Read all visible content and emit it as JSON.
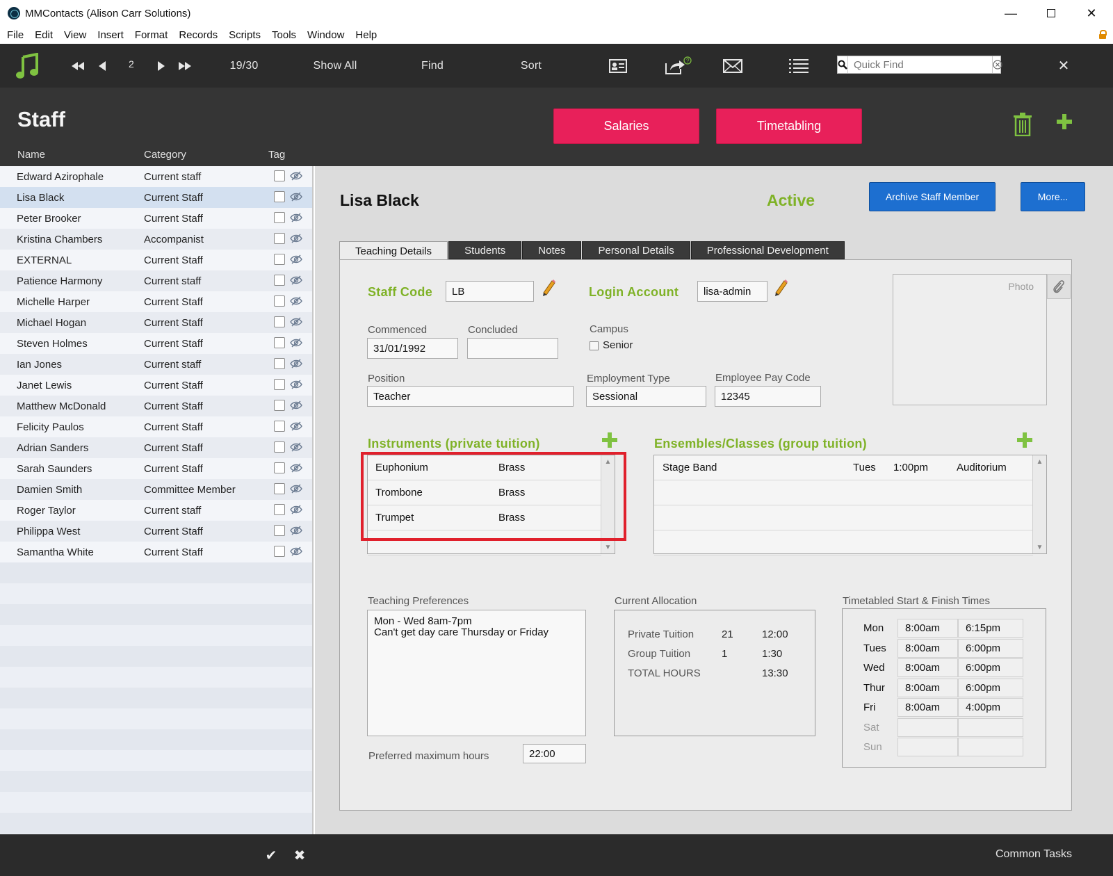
{
  "window": {
    "title": "MMContacts (Alison Carr Solutions)",
    "minimize": "—",
    "close": "✕"
  },
  "menu": [
    "File",
    "Edit",
    "View",
    "Insert",
    "Format",
    "Records",
    "Scripts",
    "Tools",
    "Window",
    "Help"
  ],
  "toolbar": {
    "record_number": "2",
    "record_count": "19/30",
    "show_all": "Show All",
    "find": "Find",
    "sort": "Sort",
    "quick_find_placeholder": "Quick Find",
    "close": "✕"
  },
  "header": {
    "title": "Staff",
    "salaries_button": "Salaries",
    "timetabling_button": "Timetabling",
    "columns": {
      "name": "Name",
      "category": "Category",
      "tag": "Tag"
    }
  },
  "staff_list": [
    {
      "name": "Edward Azirophale",
      "category": "Current staff"
    },
    {
      "name": "Lisa Black",
      "category": "Current Staff"
    },
    {
      "name": "Peter Brooker",
      "category": "Current Staff"
    },
    {
      "name": "Kristina Chambers",
      "category": "Accompanist"
    },
    {
      "name": " EXTERNAL",
      "category": "Current Staff"
    },
    {
      "name": "Patience Harmony",
      "category": "Current staff"
    },
    {
      "name": "Michelle Harper",
      "category": "Current Staff"
    },
    {
      "name": "Michael Hogan",
      "category": "Current Staff"
    },
    {
      "name": "Steven Holmes",
      "category": "Current Staff"
    },
    {
      "name": "Ian Jones",
      "category": "Current staff"
    },
    {
      "name": "Janet Lewis",
      "category": "Current Staff"
    },
    {
      "name": "Matthew McDonald",
      "category": "Current Staff"
    },
    {
      "name": "Felicity Paulos",
      "category": "Current Staff"
    },
    {
      "name": "Adrian Sanders",
      "category": "Current Staff"
    },
    {
      "name": "Sarah Saunders",
      "category": "Current Staff"
    },
    {
      "name": "Damien Smith",
      "category": "Committee Member"
    },
    {
      "name": "Roger Taylor",
      "category": "Current staff"
    },
    {
      "name": "Philippa West",
      "category": "Current Staff"
    },
    {
      "name": "Samantha White",
      "category": "Current Staff"
    }
  ],
  "selected_staff_index": 1,
  "detail": {
    "name": "Lisa Black",
    "status": "Active",
    "archive_button": "Archive Staff Member",
    "more_button": "More...",
    "tabs": [
      "Teaching Details",
      "Students",
      "Notes",
      "Personal Details",
      "Professional Development"
    ],
    "active_tab": "Teaching Details",
    "staff_code_label": "Staff Code",
    "staff_code": "LB",
    "login_account_label": "Login Account",
    "login_account": "lisa-admin",
    "photo_label": "Photo",
    "commenced_label": "Commenced",
    "commenced": "31/01/1992",
    "concluded_label": "Concluded",
    "concluded": "",
    "campus_label": "Campus",
    "campus_option": "Senior",
    "position_label": "Position",
    "position": "Teacher",
    "employment_type_label": "Employment Type",
    "employment_type": "Sessional",
    "pay_code_label": "Employee Pay Code",
    "pay_code": "12345",
    "instruments_label": "Instruments (private tuition)",
    "instruments": [
      {
        "name": "Euphonium",
        "family": "Brass"
      },
      {
        "name": "Trombone",
        "family": "Brass"
      },
      {
        "name": "Trumpet",
        "family": "Brass"
      }
    ],
    "ensembles_label": "Ensembles/Classes (group tuition)",
    "ensembles": [
      {
        "name": "Stage Band",
        "day": "Tues",
        "time": "1:00pm",
        "venue": "Auditorium"
      }
    ],
    "teaching_prefs_label": "Teaching Preferences",
    "teaching_prefs": "Mon - Wed 8am-7pm\nCan't get day care Thursday or Friday",
    "preferred_max_label": "Preferred maximum hours",
    "preferred_max": "22:00",
    "allocation_label": "Current Allocation",
    "allocation": [
      {
        "label": "Private Tuition",
        "count": "21",
        "hours": "12:00"
      },
      {
        "label": "Group Tuition",
        "count": "1",
        "hours": "1:30"
      },
      {
        "label": "TOTAL HOURS",
        "count": "",
        "hours": "13:30"
      }
    ],
    "times_label": "Timetabled Start & Finish Times",
    "times": [
      {
        "day": "Mon",
        "start": "8:00am",
        "finish": "6:15pm"
      },
      {
        "day": "Tues",
        "start": "8:00am",
        "finish": "6:00pm"
      },
      {
        "day": "Wed",
        "start": "8:00am",
        "finish": "6:00pm"
      },
      {
        "day": "Thur",
        "start": "8:00am",
        "finish": "6:00pm"
      },
      {
        "day": "Fri",
        "start": "8:00am",
        "finish": "4:00pm"
      },
      {
        "day": "Sat",
        "start": "",
        "finish": ""
      },
      {
        "day": "Sun",
        "start": "",
        "finish": ""
      }
    ]
  },
  "footer": {
    "common_tasks": "Common Tasks",
    "commit": "✔",
    "revert": "✖"
  },
  "colors": {
    "accent_green": "#7fb227",
    "pink": "#e8205a",
    "blue": "#1d6fd0",
    "highlight_red": "#e0202c"
  }
}
